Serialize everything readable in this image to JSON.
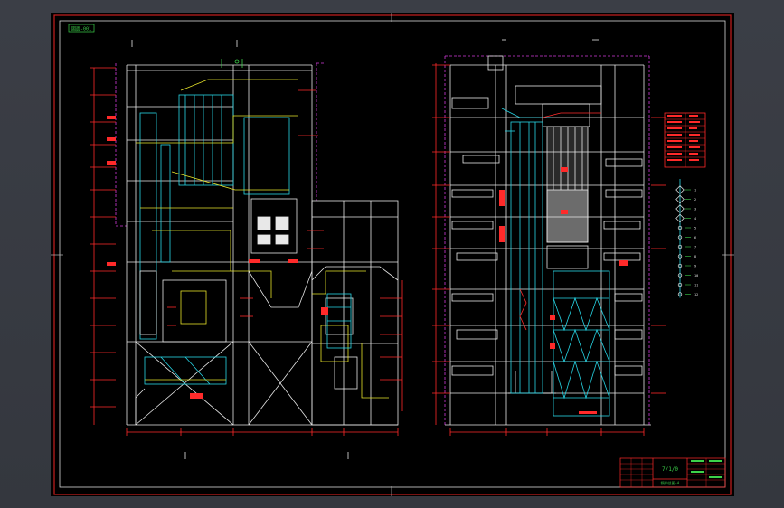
{
  "drawing": {
    "stamp_left": "図面-001",
    "title_block_code": "7/1/0",
    "title_block_caption": "锅炉总图-A",
    "legend_marks": [
      "1",
      "2",
      "3",
      "4",
      "5",
      "6",
      "7",
      "8",
      "9",
      "10",
      "11",
      "12"
    ]
  },
  "colors": {
    "background": "#000000",
    "frame_red": "#c81e1e",
    "line_white": "#e8e8e8",
    "line_cyan": "#27d6e6",
    "line_yellow": "#e6e32a",
    "line_magenta": "#d23adc",
    "line_red": "#ff2a2a",
    "line_green": "#3cd24a"
  }
}
